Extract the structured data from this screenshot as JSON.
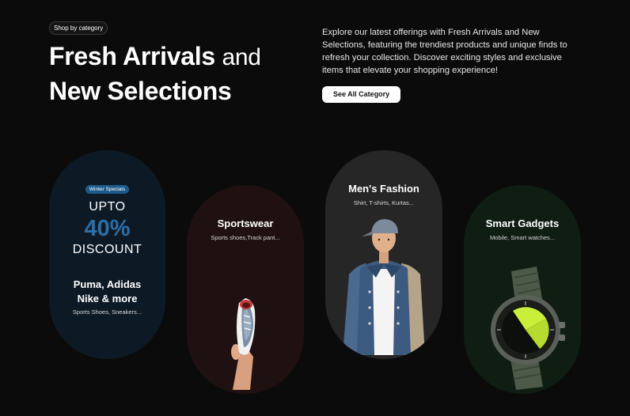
{
  "header": {
    "badge": "Shop by category",
    "title_bold_1": "Fresh Arrivals",
    "title_light": "and",
    "title_bold_2": "New Selections",
    "description": "Explore our latest offerings with Fresh Arrivals and New Selections, featuring the trendiest products and unique finds to refresh your collection. Discover exciting styles and exclusive items that elevate your shopping experience!",
    "cta_label": "See All Category"
  },
  "cards": {
    "promo": {
      "chip": "Winter Specials",
      "upto": "UPTO",
      "percent": "40%",
      "discount": "DISCOUNT",
      "brands_line1": "Puma, Adidas",
      "brands_line2": "Nike & more",
      "subtitle": "Sports Shoes, Sneakers...",
      "color_bg": "#0d1a26",
      "color_accent": "#2c6fa6"
    },
    "sportswear": {
      "title": "Sportswear",
      "subtitle": "Sports shoes,Track pant...",
      "color_bg": "#1f1111",
      "icon": "hand-holding-sneaker"
    },
    "mens": {
      "title": "Men's Fashion",
      "subtitle": "Shirt, T-shirts, Kurtas...",
      "color_bg": "#262626",
      "icon": "man-in-jacket"
    },
    "gadgets": {
      "title": "Smart Gadgets",
      "subtitle": "Mobile, Smart watches...",
      "color_bg": "#0f1d13",
      "icon": "smart-watch"
    }
  }
}
